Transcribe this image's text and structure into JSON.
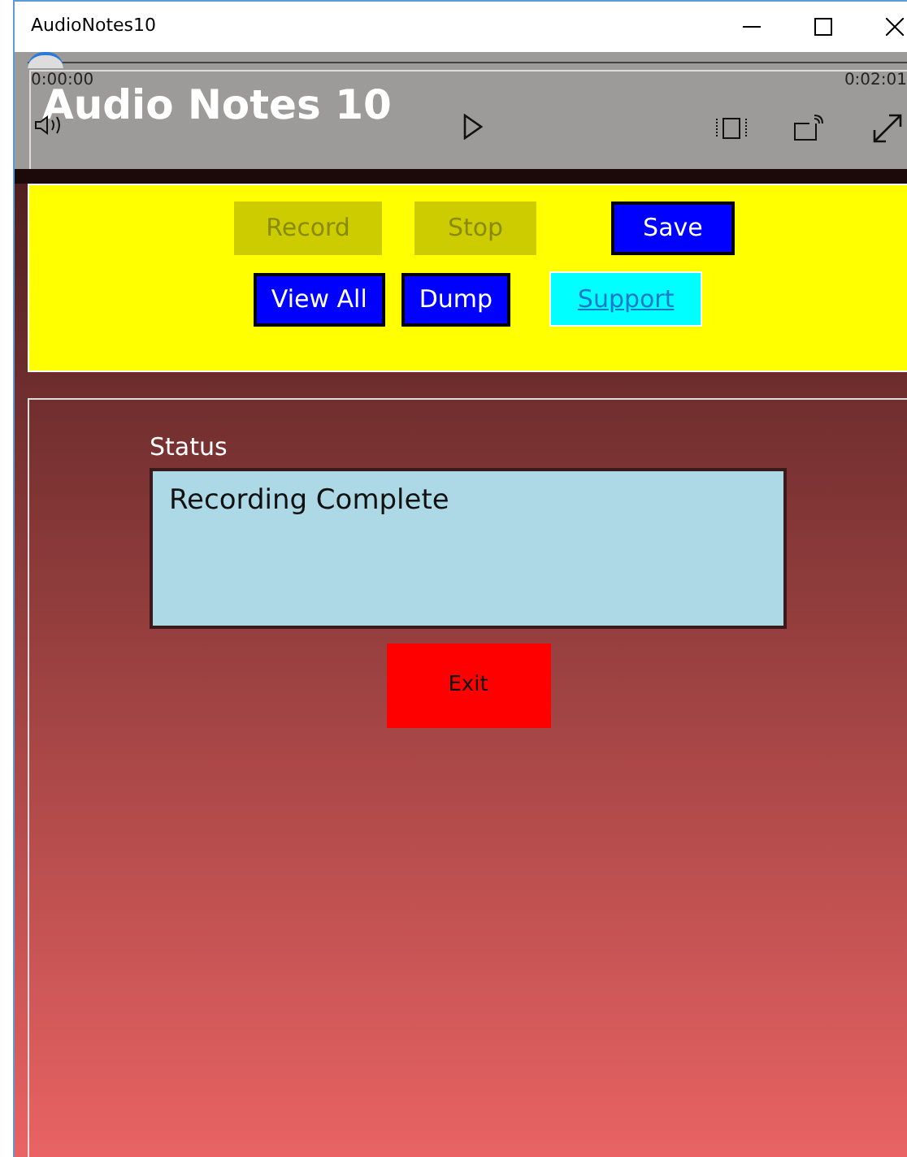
{
  "window": {
    "title": "AudioNotes10"
  },
  "player": {
    "elapsed": "0:00:00",
    "remaining": "0:02:01",
    "title": "Audio Notes 10"
  },
  "buttons_row_1": [
    {
      "label": "Record",
      "disabled": true
    },
    {
      "label": "Stop",
      "disabled": true
    },
    {
      "label": "Save",
      "disabled": false
    }
  ],
  "buttons_row_2": [
    {
      "label": "View All",
      "kind": "button"
    },
    {
      "label": "Dump",
      "kind": "button"
    },
    {
      "label": "Support",
      "kind": "link"
    }
  ],
  "status": {
    "label": "Status",
    "value": "Recording Complete"
  },
  "exit_button": {
    "label": "Exit"
  }
}
